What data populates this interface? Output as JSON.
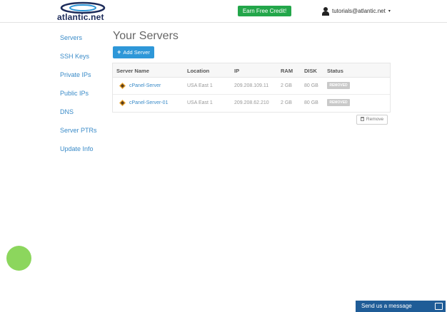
{
  "header": {
    "logo_text": "atlantic.net",
    "credit_button": "Earn Free Credit!",
    "user_email": "tutorials@atlantic.net",
    "user_caret": "▾"
  },
  "sidebar": {
    "items": [
      {
        "label": "Servers"
      },
      {
        "label": "SSH Keys"
      },
      {
        "label": "Private IPs"
      },
      {
        "label": "Public IPs"
      },
      {
        "label": "DNS"
      },
      {
        "label": "Server PTRs"
      },
      {
        "label": "Update Info"
      }
    ]
  },
  "main": {
    "title": "Your Servers",
    "add_button": "Add Server",
    "add_button_icon": "+",
    "remove_button": "Remove",
    "table": {
      "headers": [
        "Server Name",
        "Location",
        "IP",
        "RAM",
        "DISK",
        "Status"
      ],
      "rows": [
        {
          "name": "cPanel-Server",
          "location": "USA East 1",
          "ip": "209.208.109.11",
          "ram": "2 GB",
          "disk": "80 GB",
          "status": "REMOVED"
        },
        {
          "name": "cPanel-Server-01",
          "location": "USA East 1",
          "ip": "209.208.62.210",
          "ram": "2 GB",
          "disk": "80 GB",
          "status": "REMOVED"
        }
      ]
    }
  },
  "chat": {
    "label": "Send us a message"
  },
  "colors": {
    "accent": "#2e97d8",
    "credit_green": "#23a64a",
    "chat_blue": "#1f5c97",
    "link_blue": "#3a8bc8",
    "status_removed": "#c9c9c9"
  }
}
